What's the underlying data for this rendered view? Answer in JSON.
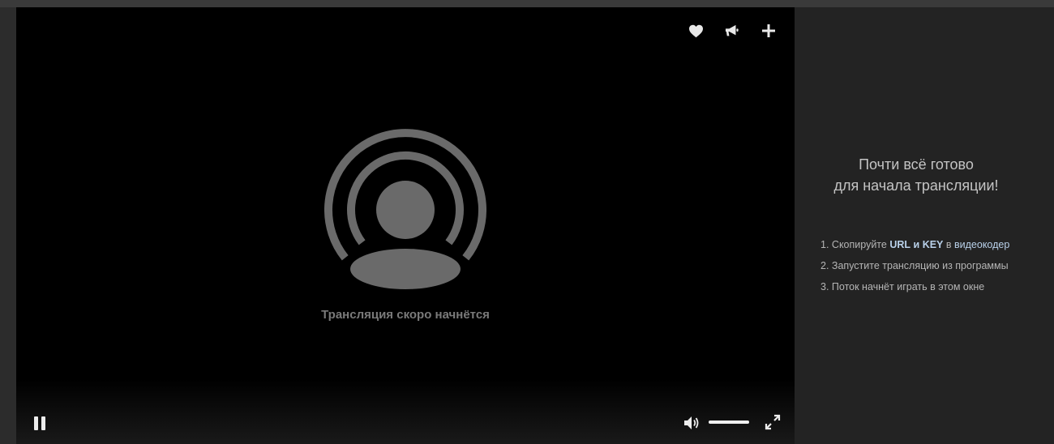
{
  "player": {
    "status_text": "Трансляция скоро начнётся",
    "actions": [
      {
        "name": "like",
        "icon": "heart-icon"
      },
      {
        "name": "share",
        "icon": "megaphone-icon"
      },
      {
        "name": "add",
        "icon": "plus-icon"
      }
    ],
    "controls": {
      "pause_icon": "pause-icon",
      "volume_icon": "speaker-icon",
      "volume_level": 1.0,
      "fullscreen_icon": "fullscreen-icon"
    }
  },
  "side_panel": {
    "title_line1": "Почти всё готово",
    "title_line2": "для начала трансляции!",
    "steps": [
      {
        "number": "1.",
        "before": "Скопируйте",
        "url": "URL",
        "and": "и",
        "key": "KEY",
        "in": "в",
        "link": "видеокодер"
      },
      {
        "number": "2.",
        "text": "Запустите трансляцию из программы"
      },
      {
        "number": "3.",
        "text": "Поток начнёт играть в этом окне"
      }
    ]
  },
  "colors": {
    "player_bg": "#000000",
    "panel_bg": "#232323",
    "accent_link": "#b9d1ea",
    "placeholder_gray": "#6a6a6a"
  }
}
